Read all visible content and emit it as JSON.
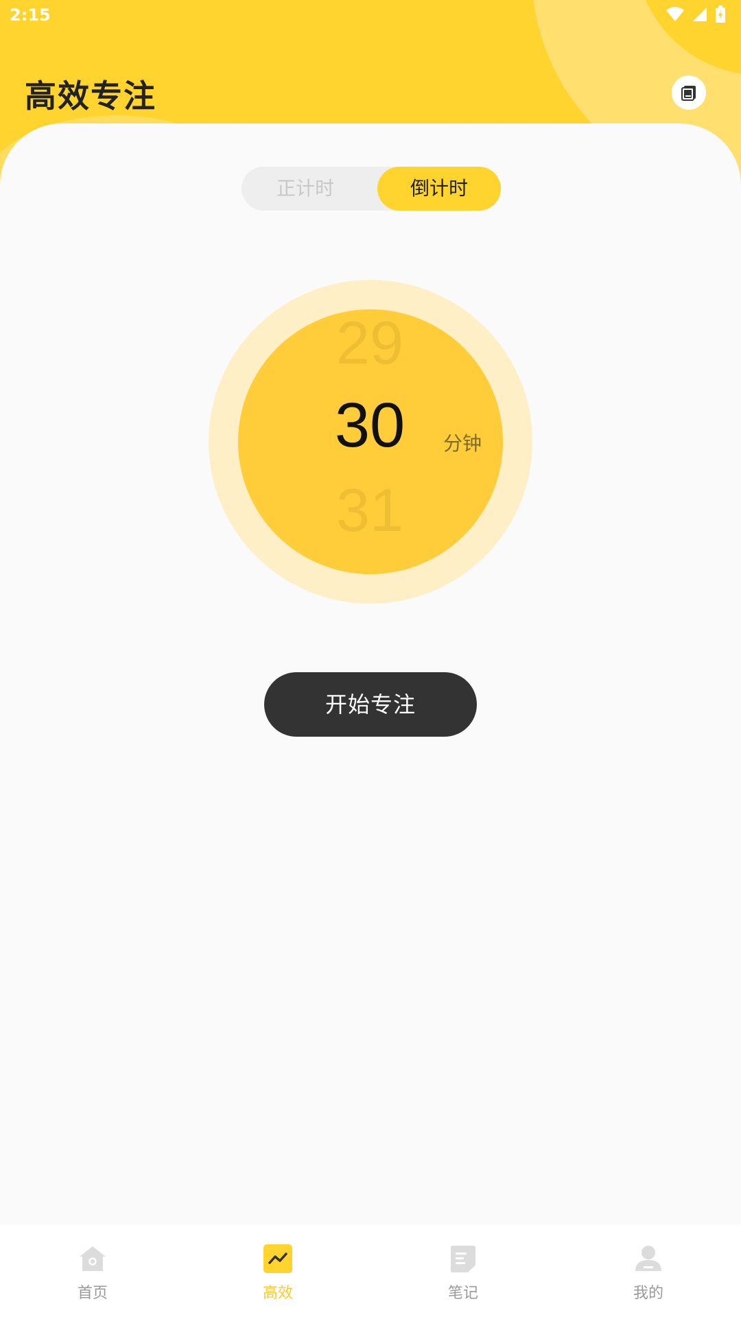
{
  "status_bar": {
    "time": "2:15"
  },
  "header": {
    "title": "高效专注",
    "action_icon": "notebook-icon"
  },
  "mode_toggle": {
    "options": [
      "正计时",
      "倒计时"
    ],
    "selected": "倒计时"
  },
  "timer_picker": {
    "prev_value": "29",
    "current_value": "30",
    "next_value": "31",
    "unit": "分钟"
  },
  "start_button": {
    "label": "开始专注"
  },
  "bottom_nav": {
    "items": [
      {
        "label": "首页",
        "icon": "home-icon"
      },
      {
        "label": "高效",
        "icon": "trend-icon"
      },
      {
        "label": "笔记",
        "icon": "note-icon"
      },
      {
        "label": "我的",
        "icon": "user-icon"
      }
    ],
    "active": "高效"
  },
  "colors": {
    "accent": "#ffd42f",
    "dial_outer": "#ffefc6",
    "dial_inner": "#ffcd3a",
    "button_dark": "#333333",
    "nav_inactive": "#9a9a9a",
    "nav_active": "#ffc928"
  }
}
